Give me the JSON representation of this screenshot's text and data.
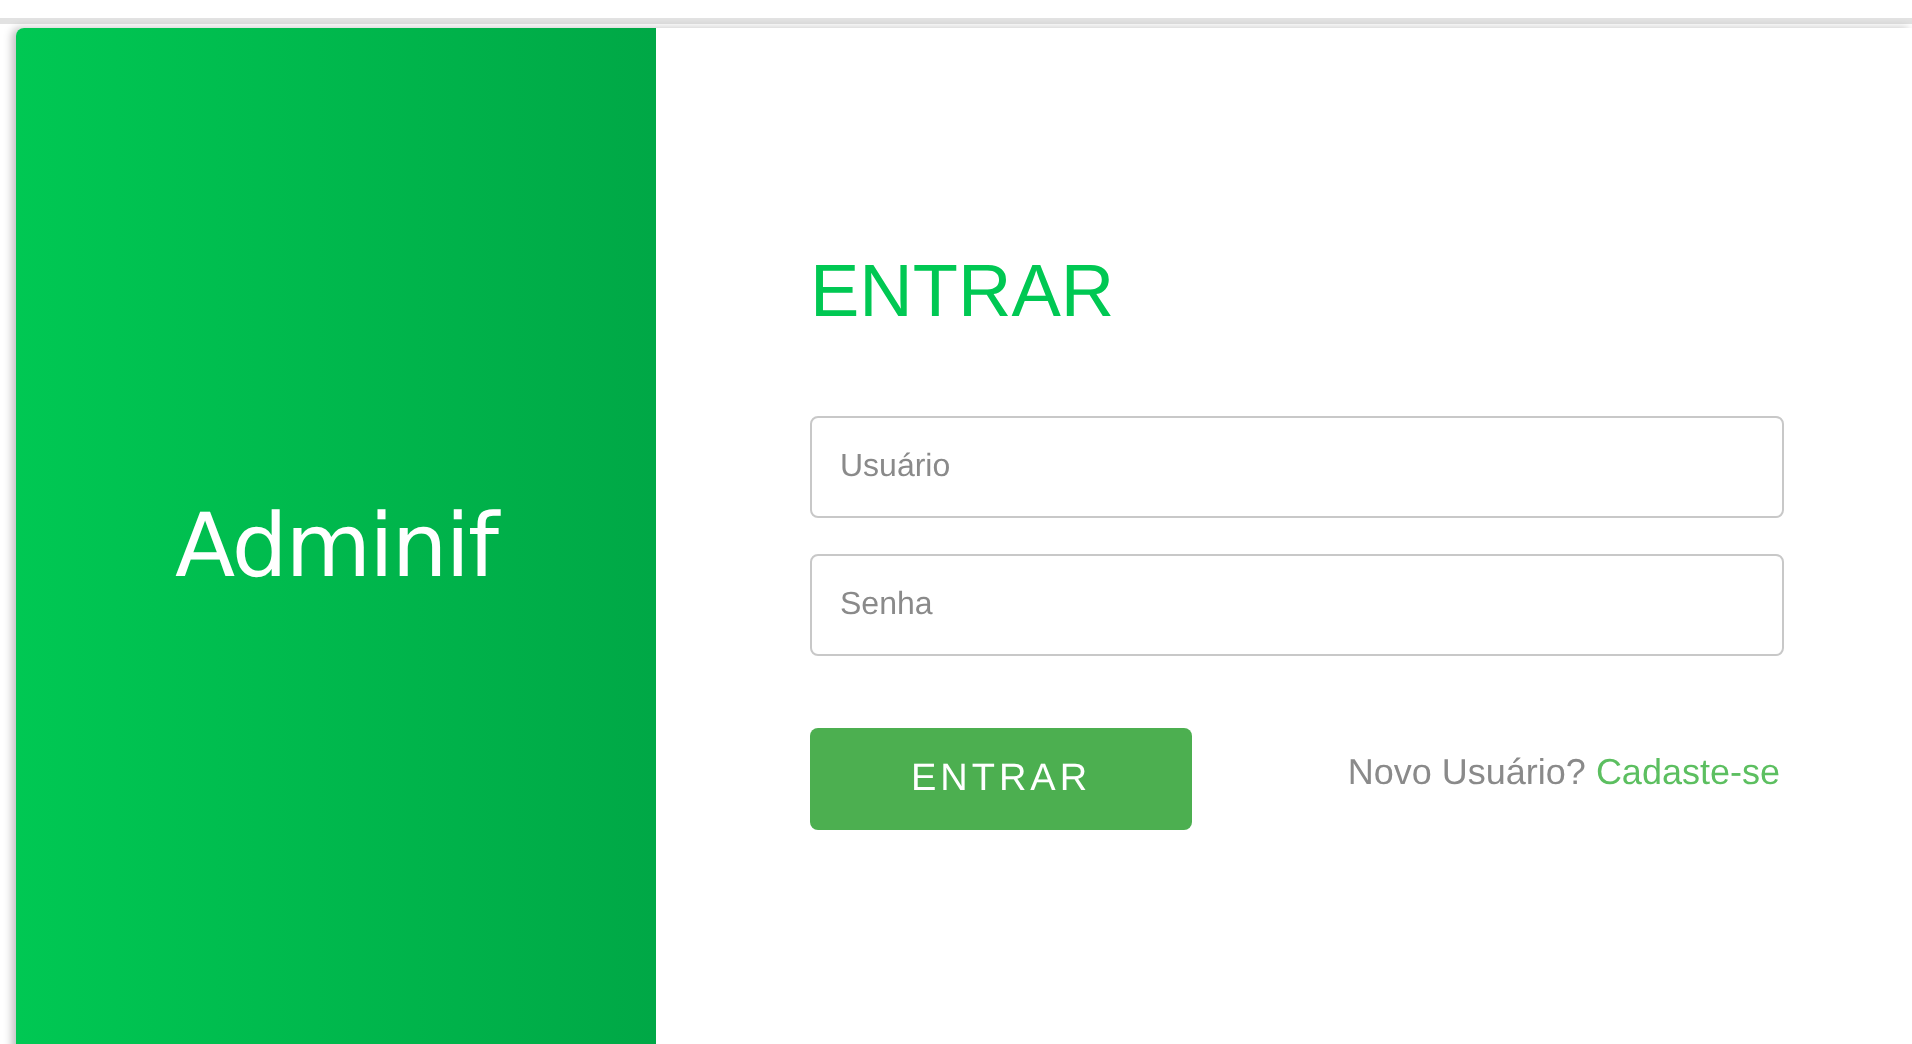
{
  "brand": {
    "logo": "Adminif"
  },
  "login": {
    "title": "ENTRAR",
    "fields": [
      {
        "placeholder": "Usuário"
      },
      {
        "placeholder": "Senha"
      }
    ],
    "submit": "ENTRAR",
    "signup": {
      "prompt": "Novo Usuário?",
      "link": "Cadaste-se"
    }
  }
}
